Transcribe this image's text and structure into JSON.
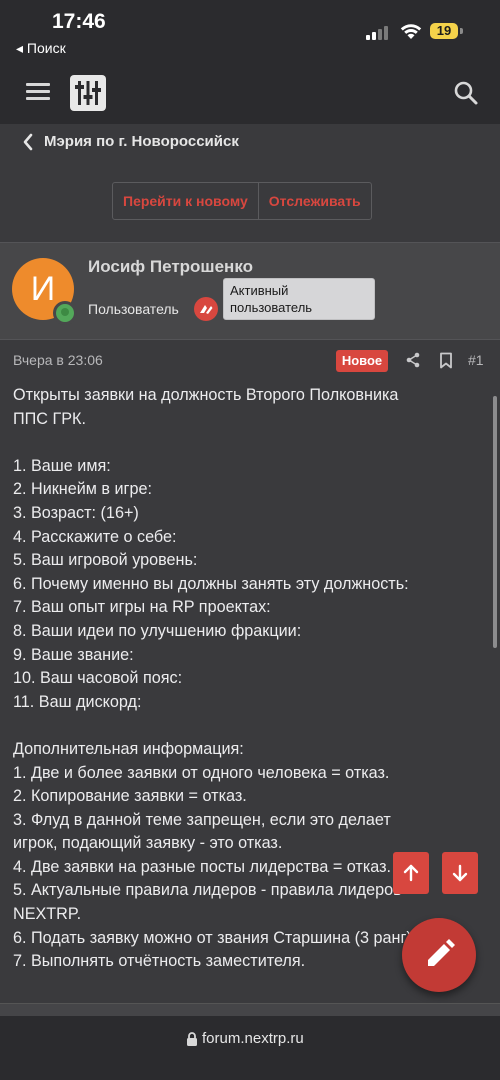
{
  "status_bar": {
    "time": "17:46",
    "back_label": "◂ Поиск",
    "battery": "19"
  },
  "header": {
    "menu_icon": "hamburger-icon",
    "logo_icon": "sliders-logo-icon",
    "search_icon": "search-icon"
  },
  "breadcrumb": {
    "label": "Мэрия по г. Новороссийск"
  },
  "actions": {
    "goto_new": "Перейти к новому",
    "follow": "Отслеживать"
  },
  "author": {
    "avatar_letter": "И",
    "name": "Иосиф Петрошенко",
    "role": "Пользователь",
    "tooltip": "Активный пользователь"
  },
  "post": {
    "date": "Вчера в 23:06",
    "badge": "Новое",
    "number": "#1",
    "lines": [
      "Открыты заявки на должность Второго Полковника",
      "ППС ГРК.",
      "",
      "1. Ваше имя:",
      "2. Никнейм в игре:",
      "3. Возраст: (16+)",
      "4. Расскажите о себе:",
      "5. Ваш игровой уровень:",
      "6. Почему именно вы должны занять эту должность:",
      "7. Ваш опыт игры на RP проектах:",
      "8. Ваши идеи по улучшению фракции:",
      "9. Ваше звание:",
      "10. Ваш часовой пояс:",
      "11. Ваш дискорд:",
      "",
      "Дополнительная информация:",
      "1. Две и более заявки от одного человека = отказ.",
      "2. Копирование заявки = отказ.",
      "3. Флуд в данной теме запрещен, если это делает",
      "игрок, подающий заявку - это отказ.",
      "4. Две заявки на разные посты лидерства = отказ.",
      "5. Актуальные правила лидеров - правила лидеров",
      "NEXTRP.",
      "6. Подать заявку можно от звания Старшина (3 ранг)",
      "7. Выполнять отчётность заместителя."
    ]
  },
  "url": {
    "domain": "forum.nextrp.ru"
  },
  "colors": {
    "accent": "#d8473f",
    "avatar": "#ee8b2c",
    "background": "#3a3a3d"
  }
}
